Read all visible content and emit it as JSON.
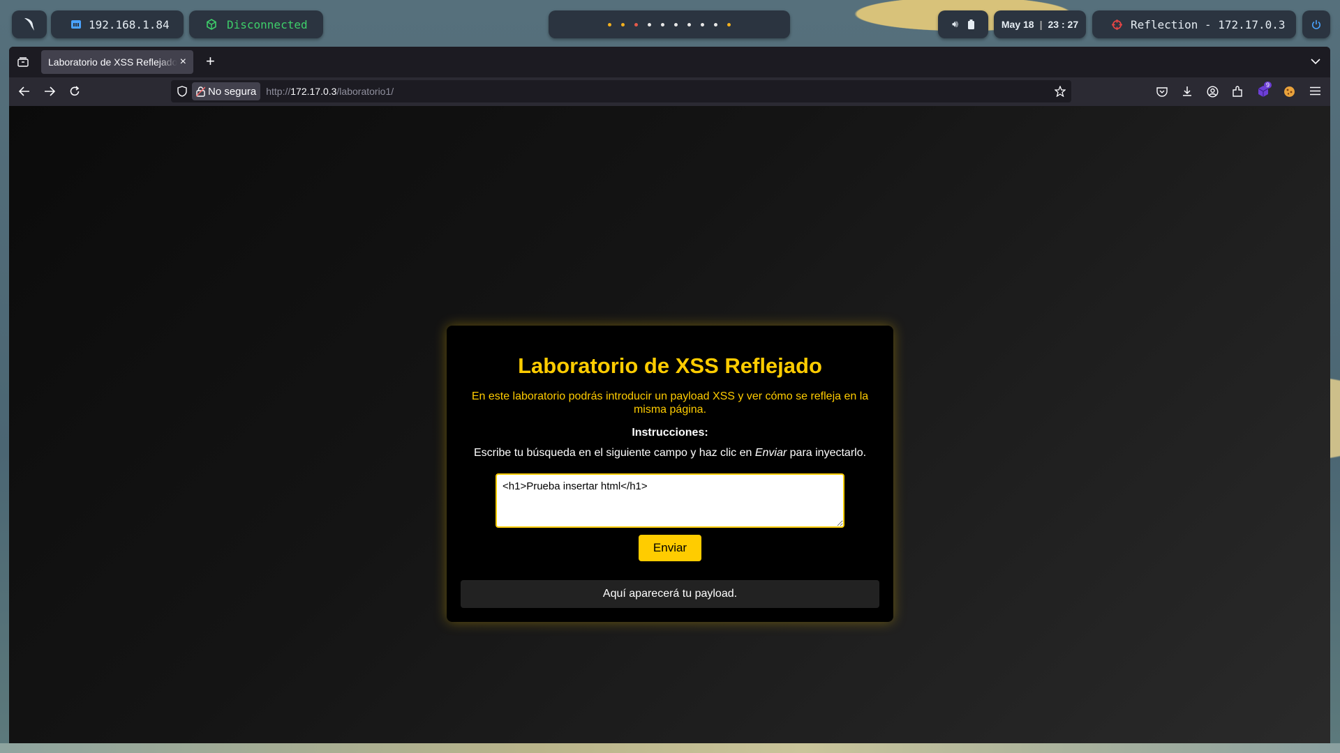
{
  "topbar": {
    "ip": "192.168.1.84",
    "vpn_status": "Disconnected",
    "workspaces": [
      {
        "state": "active"
      },
      {
        "state": "active"
      },
      {
        "state": "warn"
      },
      {
        "state": "idle"
      },
      {
        "state": "idle"
      },
      {
        "state": "idle"
      },
      {
        "state": "idle"
      },
      {
        "state": "idle"
      },
      {
        "state": "idle"
      },
      {
        "state": "active"
      }
    ],
    "date": "May 18",
    "time": "23 : 27",
    "target": "Reflection - 172.17.0.3"
  },
  "browser": {
    "tab_title": "Laboratorio de XSS Reflejado",
    "security_label": "No segura",
    "url_prefix": "http://",
    "url_host": "172.17.0.3",
    "url_path": "/laboratorio1/",
    "extension_badge": "9"
  },
  "page": {
    "title": "Laboratorio de XSS Reflejado",
    "description": "En este laboratorio podrás introducir un payload XSS y ver cómo se refleja en la misma página.",
    "instructions_heading": "Instrucciones:",
    "instructions_before": "Escribe tu búsqueda en el siguiente campo y haz clic en ",
    "instructions_em": "Enviar",
    "instructions_after": " para inyectarlo.",
    "input_value": "<h1>Prueba insertar html</h1>",
    "submit_label": "Enviar",
    "result_text": "Aquí aparecerá tu payload."
  },
  "colors": {
    "accent": "#ffcc00",
    "vpn_disconnected": "#3ecf6a"
  }
}
